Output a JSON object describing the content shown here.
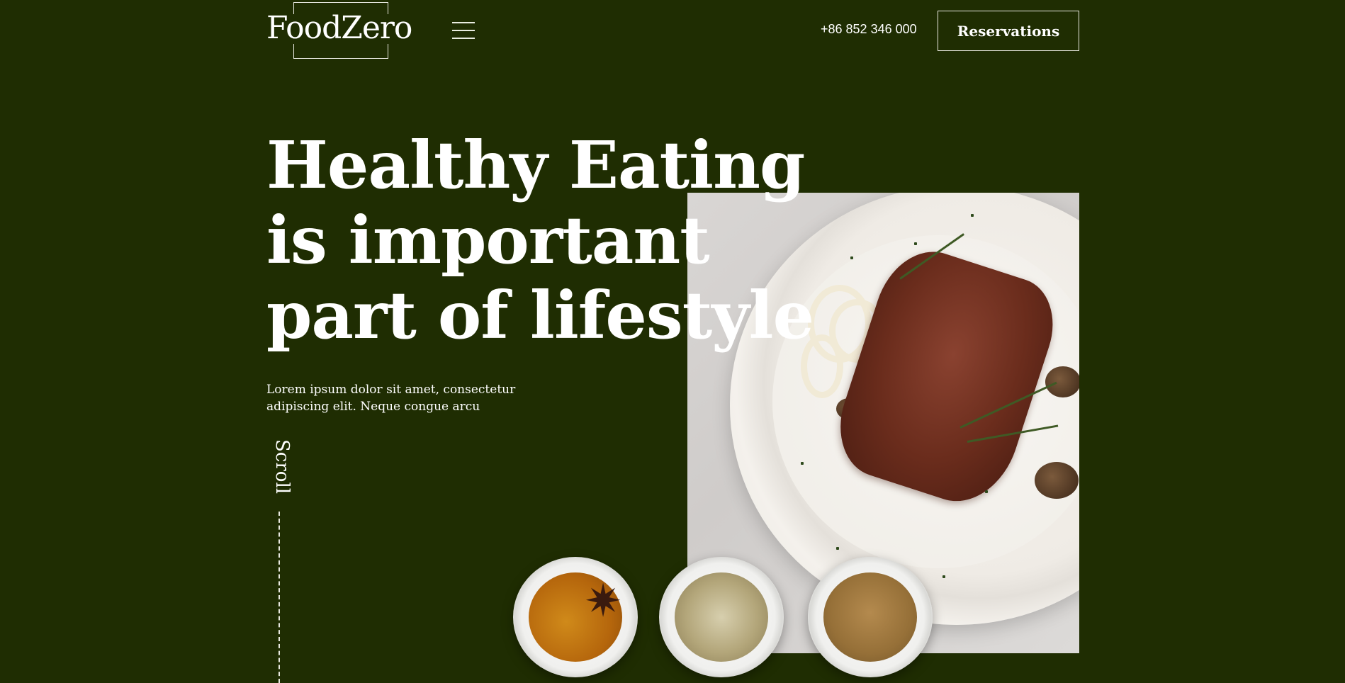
{
  "header": {
    "logo_text": "FoodZero",
    "phone": "+86 852 346 000",
    "reservations_label": "Reservations"
  },
  "hero": {
    "headline_lines": [
      "Healthy Eating",
      "is important",
      "part of lifestyle"
    ],
    "lead": "Lorem ipsum dolor sit amet, consectetur adipiscing elit. Neque congue arcu",
    "scroll_label": "Scroll"
  },
  "icons": {
    "menu": "hamburger-menu-icon"
  },
  "colors": {
    "background": "#1f2d02",
    "text": "#ffffff",
    "accent_border": "#e8e8e0"
  }
}
